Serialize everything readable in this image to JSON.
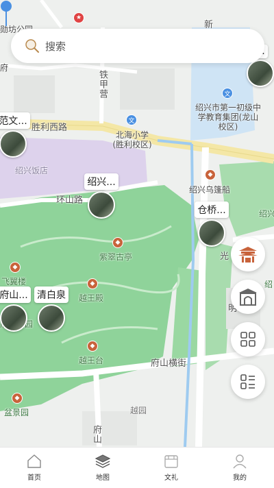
{
  "search": {
    "placeholder": "搜索"
  },
  "map": {
    "roads": {
      "shengli_west": "胜利西路",
      "huanshan": "环山路",
      "fushan_heng": "府山横街",
      "tiejiaying": "铁甲营",
      "fushan_bottom": "府山",
      "xin": "新",
      "guang": "光",
      "ming": "明"
    },
    "places": {
      "top_left": "勋坊公园",
      "fu": "府",
      "beihai_school": "北海小学(胜利校区)",
      "first_school": "绍兴市第一初级中学教育集团(龙山校区)",
      "hotel": "绍兴饭店",
      "wupeng_boat": "绍兴乌篷船",
      "cuicui_pavilion": "紫翠古亭",
      "feiyi_tower": "飞翼楼",
      "yuewang_hall": "越王殿",
      "fushan_park": "府山公园",
      "yuewang_terrace": "越王台",
      "penjing_garden": "盆景园",
      "yueyuan": "越园",
      "shao_right": "绍",
      "shao_right2": "绍兴"
    },
    "cards": [
      {
        "title": "范文..."
      },
      {
        "title": "绍兴..."
      },
      {
        "title": "仓桥..."
      },
      {
        "title": "府山..."
      },
      {
        "title": "清白泉"
      },
      {
        "title": "..."
      }
    ]
  },
  "fabs": [
    {
      "icon": "palace-icon"
    },
    {
      "icon": "gate-icon"
    },
    {
      "icon": "grid-icon"
    },
    {
      "icon": "list-icon"
    }
  ],
  "tabs": [
    {
      "label": "首页",
      "icon": "home-icon"
    },
    {
      "label": "地图",
      "icon": "layers-icon"
    },
    {
      "label": "文礼",
      "icon": "gift-shop-icon"
    },
    {
      "label": "我的",
      "icon": "user-icon"
    }
  ],
  "colors": {
    "accent": "#c8633b",
    "park": "#8fd39a",
    "hotel": "#d6cbe8",
    "water": "#cfe4f5",
    "main_road": "#f4e7a6"
  }
}
